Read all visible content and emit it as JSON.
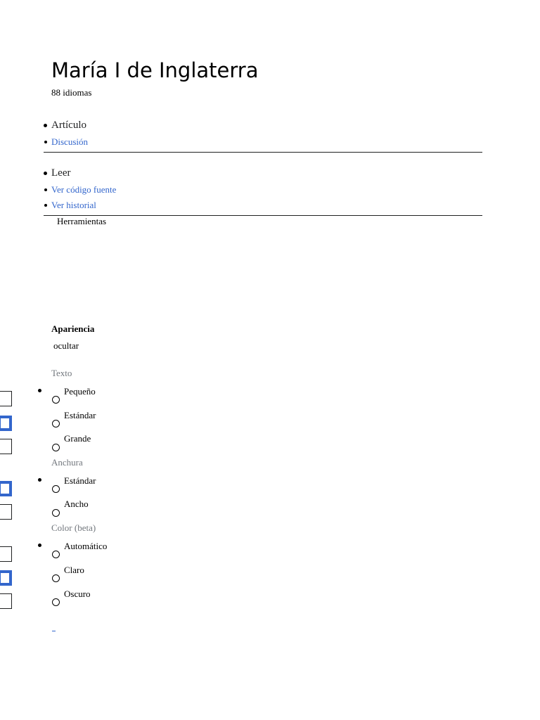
{
  "article": {
    "title": "María I de Inglaterra",
    "languages": "88 idiomas"
  },
  "namespaces": {
    "items": [
      {
        "label": "Artículo",
        "current": true
      },
      {
        "label": "Discusión",
        "current": false
      }
    ]
  },
  "views": {
    "items": [
      {
        "label": "Leer",
        "current": true
      },
      {
        "label": "Ver código fuente",
        "current": false
      },
      {
        "label": "Ver historial",
        "current": false
      }
    ]
  },
  "tools": {
    "label": "Herramientas"
  },
  "appearance": {
    "heading": "Apariencia",
    "hide_label": "ocultar",
    "groups": [
      {
        "label": "Texto",
        "options": [
          {
            "label": "Pequeño",
            "selected": false
          },
          {
            "label": "Estándar",
            "selected": true
          },
          {
            "label": "Grande",
            "selected": false
          }
        ]
      },
      {
        "label": "Anchura",
        "options": [
          {
            "label": "Estándar",
            "selected": true
          },
          {
            "label": "Ancho",
            "selected": false
          }
        ]
      },
      {
        "label": "Color (beta)",
        "options": [
          {
            "label": "Automático",
            "selected": false
          },
          {
            "label": "Claro",
            "selected": true
          },
          {
            "label": "Oscuro",
            "selected": false
          }
        ]
      }
    ]
  },
  "colors": {
    "link": "#3366cc",
    "selected_outline": "#3366cc",
    "muted_label": "#72777d"
  }
}
